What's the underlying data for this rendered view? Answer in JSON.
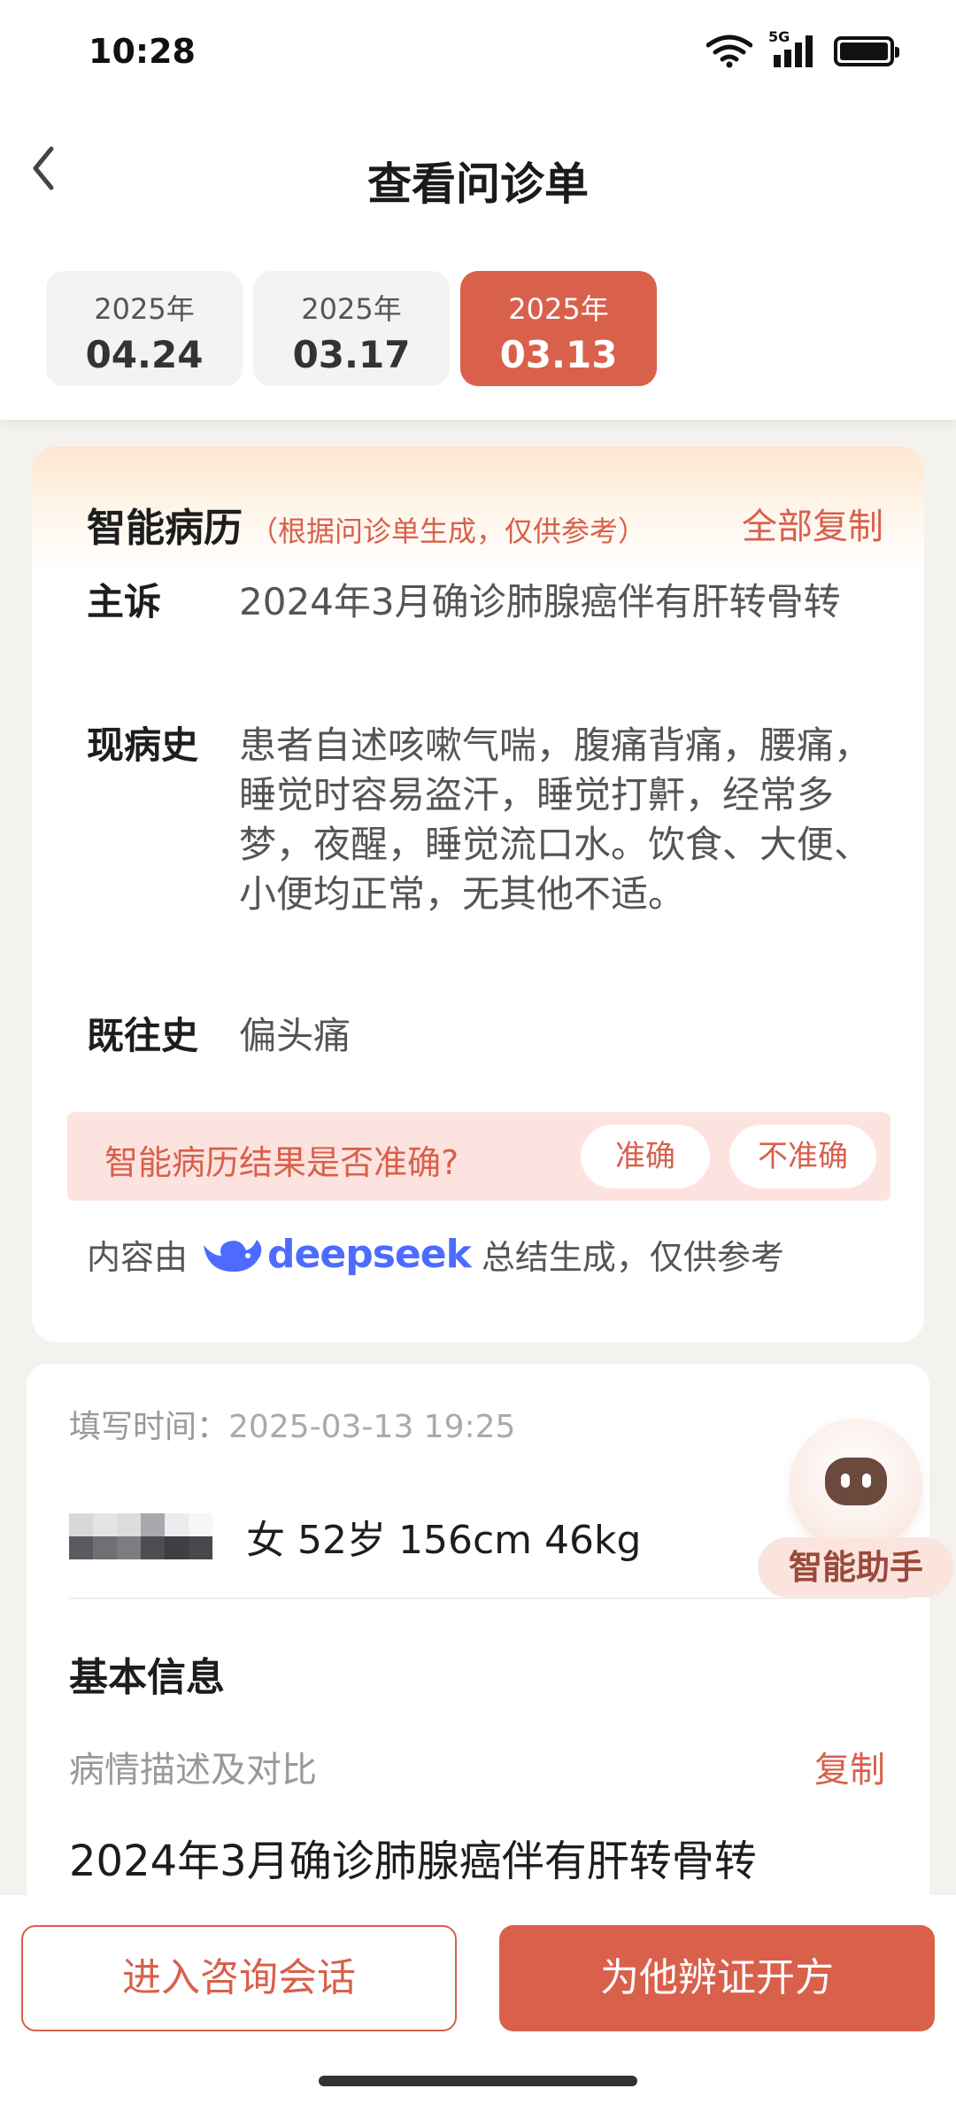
{
  "status_bar": {
    "time": "10:28",
    "network": "5G",
    "icons": [
      "wifi-icon",
      "signal-icon",
      "battery-icon"
    ]
  },
  "nav": {
    "title": "查看问诊单",
    "back_icon": "back-icon"
  },
  "date_tabs": [
    {
      "year": "2025年",
      "day": "04.24",
      "active": false
    },
    {
      "year": "2025年",
      "day": "03.17",
      "active": false
    },
    {
      "year": "2025年",
      "day": "03.13",
      "active": true
    }
  ],
  "smart_record": {
    "title": "智能病历",
    "subtitle": "（根据问诊单生成，仅供参考）",
    "copy_all": "全部复制",
    "rows": [
      {
        "label": "主诉",
        "value": "2024年3月确诊肺腺癌伴有肝转骨转"
      },
      {
        "label": "现病史",
        "value": "患者自述咳嗽气喘，腹痛背痛，腰痛，睡觉时容易盗汗，睡觉打鼾，经常多梦，夜醒，睡觉流口水。饮食、大便、小便均正常，无其他不适。"
      },
      {
        "label": "既往史",
        "value": "偏头痛"
      }
    ],
    "feedback": {
      "question": "智能病历结果是否准确?",
      "accurate": "准确",
      "inaccurate": "不准确"
    },
    "source": {
      "prefix": "内容由",
      "brand": "deepseek",
      "suffix": "总结生成，仅供参考"
    }
  },
  "info": {
    "fill_time_label": "填写时间：",
    "fill_time_value": "2025-03-13 19:25",
    "patient_summary": "女 52岁 156cm 46kg",
    "section_title": "基本信息",
    "desc_label": "病情描述及对比",
    "desc_copy": "复制",
    "desc_text": "2024年3月确诊肺腺癌伴有肝转骨转"
  },
  "assistant": {
    "label": "智能助手"
  },
  "bottom": {
    "consult_label": "进入咨询会话",
    "prescribe_label": "为他辨证开方"
  },
  "colors": {
    "accent": "#d9604b",
    "feedback_bg": "#fde3df",
    "deepseek_blue": "#4d6bfe"
  }
}
